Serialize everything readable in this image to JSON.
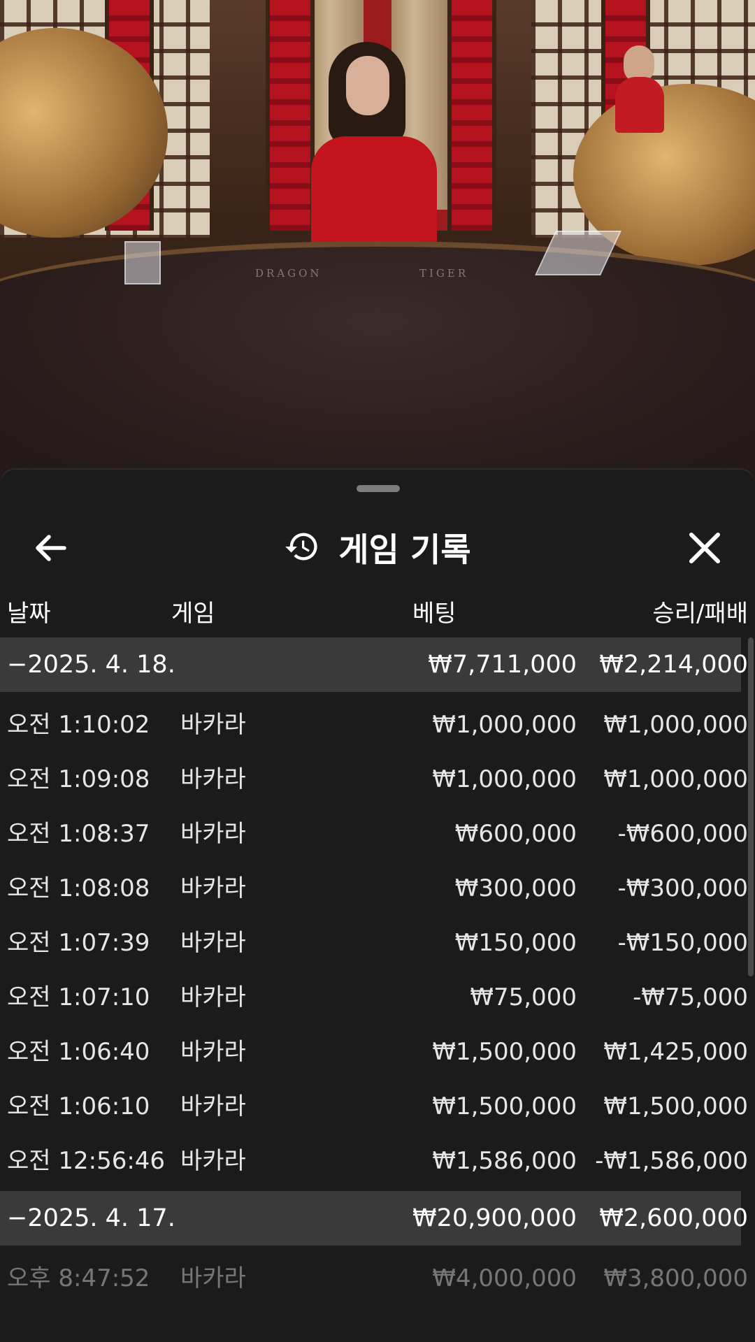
{
  "sheet": {
    "title": "게임 기록",
    "icons": {
      "back": "arrow-left-icon",
      "history": "history-icon",
      "close": "close-icon"
    }
  },
  "columns": {
    "date": "날짜",
    "game": "게임",
    "bet": "베팅",
    "result": "승리/패배"
  },
  "groups": [
    {
      "date": "−2025. 4. 18.",
      "bet_total": "₩7,711,000",
      "result_total": "₩2,214,000",
      "rows": [
        {
          "time": "오전 1:10:02",
          "game": "바카라",
          "bet": "₩1,000,000",
          "result": "₩1,000,000"
        },
        {
          "time": "오전 1:09:08",
          "game": "바카라",
          "bet": "₩1,000,000",
          "result": "₩1,000,000"
        },
        {
          "time": "오전 1:08:37",
          "game": "바카라",
          "bet": "₩600,000",
          "result": "-₩600,000"
        },
        {
          "time": "오전 1:08:08",
          "game": "바카라",
          "bet": "₩300,000",
          "result": "-₩300,000"
        },
        {
          "time": "오전 1:07:39",
          "game": "바카라",
          "bet": "₩150,000",
          "result": "-₩150,000"
        },
        {
          "time": "오전 1:07:10",
          "game": "바카라",
          "bet": "₩75,000",
          "result": "-₩75,000"
        },
        {
          "time": "오전 1:06:40",
          "game": "바카라",
          "bet": "₩1,500,000",
          "result": "₩1,425,000"
        },
        {
          "time": "오전 1:06:10",
          "game": "바카라",
          "bet": "₩1,500,000",
          "result": "₩1,500,000"
        },
        {
          "time": "오전 12:56:46",
          "game": "바카라",
          "bet": "₩1,586,000",
          "result": "-₩1,586,000"
        }
      ]
    },
    {
      "date": "−2025. 4. 17.",
      "bet_total": "₩20,900,000",
      "result_total": "₩2,600,000",
      "rows": [
        {
          "time": "오후 8:47:52",
          "game": "바카라",
          "bet": "₩4,000,000",
          "result": "₩3,800,000"
        }
      ]
    }
  ],
  "table_felt": {
    "left_label": "DRAGON",
    "right_label": "TIGER"
  },
  "colors": {
    "sheet_bg": "#1b1b1b",
    "group_row_bg": "#3a3a3a",
    "text": "#ffffff",
    "dealer_dress": "#c3141d"
  }
}
